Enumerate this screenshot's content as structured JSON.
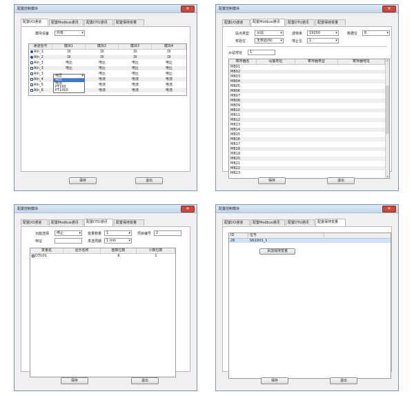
{
  "title": "配置控制模块",
  "close_glyph": "✕",
  "dropdown_arrow": "▾",
  "tabs": [
    "配置I/O通道",
    "配置Modbus通讯",
    "配置DTU通讯",
    "配置保持变量"
  ],
  "buttons": {
    "save": "保存",
    "exit": "退出"
  },
  "panel1": {
    "module_label": "模块设备",
    "module_value": "共有",
    "columns": [
      "通道信号",
      "模块1",
      "模块2",
      "模块3",
      "模块4"
    ],
    "rows": [
      {
        "name": "AIn_1",
        "icon": "round",
        "c1": "DI",
        "c2": "DI",
        "c3": "DI",
        "c4": "DI"
      },
      {
        "name": "AIn_2",
        "icon": "round",
        "c1": "DI",
        "c2": "DI",
        "c3": "DI",
        "c4": "DI"
      },
      {
        "name": "AIn_3",
        "icon": "square",
        "c1": "电压",
        "c2": "电压",
        "c3": "电压",
        "c4": "电压"
      },
      {
        "name": "AIn_3",
        "icon": "square",
        "c1": "电压",
        "c2": "电压",
        "c3": "电压",
        "c4": "电压"
      },
      {
        "name": "AIn_3",
        "icon": "square",
        "c1": "",
        "c2": "电压",
        "c3": "电压",
        "c4": "电压"
      },
      {
        "name": "AIn_4",
        "icon": "square",
        "c1": "",
        "c2": "电流",
        "c3": "电流",
        "c4": "电流"
      },
      {
        "name": "AIn_5",
        "icon": "square",
        "c1": "",
        "c2": "电流",
        "c3": "电流",
        "c4": "电流"
      },
      {
        "name": "AIn_6",
        "icon": "square",
        "c1": "",
        "c2": "电流",
        "c3": "电流",
        "c4": "电流"
      }
    ],
    "dropdown": {
      "selected": "电压",
      "options": [
        "电压",
        "电流",
        "PT100",
        "PT1000"
      ]
    }
  },
  "panel2": {
    "station_type_label": "站点类型",
    "station_type_value": "从站",
    "baud_label": "波特率",
    "baud_value": "19200",
    "data_bits_label": "数据位",
    "data_bits_value": "8",
    "parity_label": "校验位",
    "parity_value": "无校验(N)",
    "stop_bits_label": "停止位",
    "stop_bits_value": "1",
    "slave_addr_label": "从站地址",
    "slave_addr_value": "1",
    "columns": [
      "寄存器名",
      "设备地址",
      "寄存器类型",
      "寄存器地址"
    ],
    "rows": [
      "MB01",
      "MB02",
      "MB03",
      "MB04",
      "MB05",
      "MB06",
      "MB07",
      "MB08",
      "MB09",
      "MB10",
      "MB11",
      "MB12",
      "MB13",
      "MB14",
      "MB15",
      "MB16",
      "MB17",
      "MB18",
      "MB19",
      "MB20",
      "MB21",
      "MB22",
      "MB23"
    ]
  },
  "panel3": {
    "func_label": "功能选择",
    "func_value": "停止",
    "var_count_label": "变量数量",
    "var_count_value": "1",
    "project_no_label": "项目编号",
    "project_no_value": "2",
    "feature_label": "特征",
    "feature_value": "",
    "send_period_label": "发送周期",
    "send_period_value": "1 min",
    "columns": [
      "变量名",
      "显示名称",
      "整数位数",
      "小数位数"
    ],
    "rows": [
      {
        "name": "DTU01",
        "display": "",
        "int_digits": "6",
        "dec_digits": "1"
      }
    ]
  },
  "panel4": {
    "columns": [
      "ID",
      "位号"
    ],
    "rows": [
      {
        "id": "26",
        "tag": "S62D01_1"
      }
    ],
    "add_button": "添加保持变量"
  }
}
